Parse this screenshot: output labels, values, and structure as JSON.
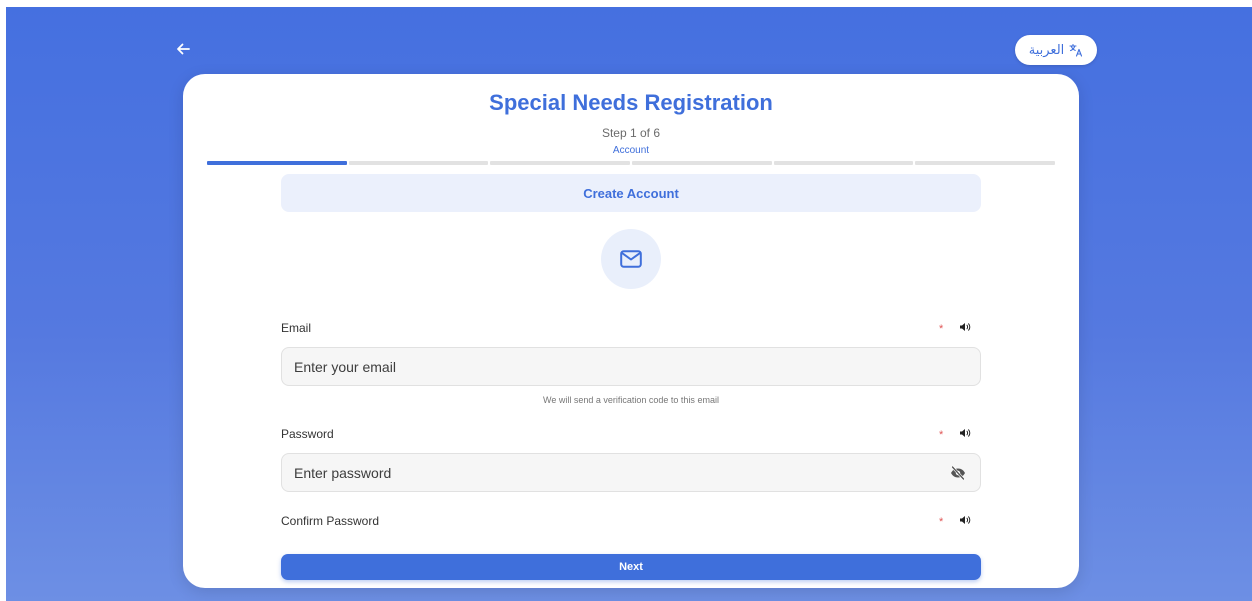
{
  "header": {
    "language_label": "العربية"
  },
  "form": {
    "title": "Special Needs Registration",
    "step_text": "Step 1 of 6",
    "step_name": "Account",
    "progress": {
      "current": 1,
      "total": 6
    },
    "section_title": "Create Account",
    "fields": {
      "email": {
        "label": "Email",
        "required_mark": "*",
        "placeholder": "Enter your email",
        "value": "",
        "hint": "We will send a verification code to this email"
      },
      "password": {
        "label": "Password",
        "required_mark": "*",
        "placeholder": "Enter password",
        "value": ""
      },
      "confirm_password": {
        "label": "Confirm Password",
        "required_mark": "*"
      }
    },
    "next_label": "Next"
  },
  "colors": {
    "accent": "#3f6fdb",
    "background": "#4570e0",
    "required": "#e05555"
  },
  "icons": {
    "back": "arrow-left-icon",
    "language": "translate-icon",
    "section": "mail-icon",
    "speaker": "speaker-icon",
    "password_visibility": "eye-off-icon"
  }
}
